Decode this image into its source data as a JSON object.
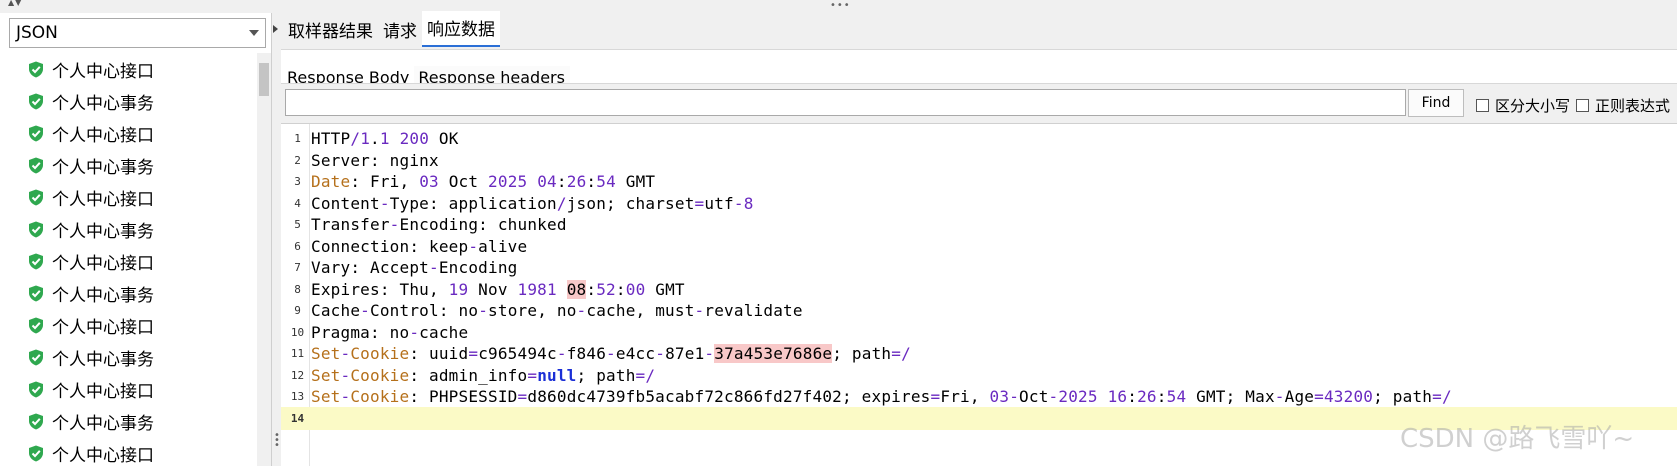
{
  "left": {
    "format_select": "JSON",
    "tree_items": [
      "个人中心接口",
      "个人中心事务",
      "个人中心接口",
      "个人中心事务",
      "个人中心接口",
      "个人中心事务",
      "个人中心接口",
      "个人中心事务",
      "个人中心接口",
      "个人中心事务",
      "个人中心接口",
      "个人中心事务",
      "个人中心接口"
    ]
  },
  "tabs": {
    "main": [
      "取样器结果",
      "请求",
      "响应数据"
    ],
    "main_active": 2,
    "sub": [
      "Response Body",
      "Response headers"
    ],
    "sub_active": 1
  },
  "search": {
    "value": "",
    "find_label": "Find",
    "case_label": "区分大小写",
    "regex_label": "正则表达式"
  },
  "editor": {
    "current_line": 14,
    "line_numbers": [
      "1",
      "2",
      "3",
      "4",
      "5",
      "6",
      "7",
      "8",
      "9",
      "10",
      "11",
      "12",
      "13",
      "14"
    ],
    "lines": [
      "HTTP/1.1 200 OK",
      "Server: nginx",
      "Date: Fri, 03 Oct 2025 04:26:54 GMT",
      "Content-Type: application/json; charset=utf-8",
      "Transfer-Encoding: chunked",
      "Connection: keep-alive",
      "Vary: Accept-Encoding",
      "Expires: Thu, 19 Nov 1981 08:52:00 GMT",
      "Cache-Control: no-store, no-cache, must-revalidate",
      "Pragma: no-cache",
      "Set-Cookie: uuid=c965494c-f846-e4cc-87e1-37a453e7686e; path=/",
      "Set-Cookie: admin_info=null; path=/",
      "Set-Cookie: PHPSESSID=d860dc4739fb5acabf72c866fd27f402; expires=Fri, 03-Oct-2025 16:26:54 GMT; Max-Age=43200; path=/",
      ""
    ]
  },
  "watermark": "CSDN @路飞雪吖~",
  "colors": {
    "accent_tab": "#2b6fd6",
    "current_line": "#fbfac6",
    "highlight": "#f8c8c8",
    "number": "#6a2ac0",
    "keyword_orange": "#b5701b"
  }
}
